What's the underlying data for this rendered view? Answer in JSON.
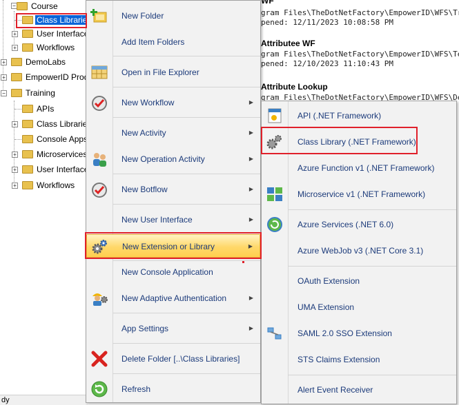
{
  "tree": {
    "items": [
      {
        "label": "Course",
        "expander": "-"
      },
      {
        "label": "Class Libraries",
        "selected": true
      },
      {
        "label": "User Interface",
        "expander": "+"
      },
      {
        "label": "Workflows",
        "expander": "+"
      },
      {
        "label": "DemoLabs",
        "expander": "+"
      },
      {
        "label": "EmpowerID Prod",
        "expander": "+"
      },
      {
        "label": "Training",
        "expander": "-"
      },
      {
        "label": "APIs"
      },
      {
        "label": "Class Libraries",
        "expander": "+"
      },
      {
        "label": "Console Apps"
      },
      {
        "label": "Microservices",
        "expander": "+"
      },
      {
        "label": "User Interface",
        "expander": "+"
      },
      {
        "label": "Workflows",
        "expander": "+"
      }
    ]
  },
  "statusbar": {
    "text": "dy"
  },
  "background": {
    "lines": [
      "WF",
      "gram Files\\TheDotNetFactory\\EmpowerID\\WFS\\Tra",
      "pened: 12/11/2023 10:08:58 PM",
      "Attributee WF",
      "gram Files\\TheDotNetFactory\\EmpowerID\\WFS\\Te",
      "pened: 12/10/2023 11:10:43 PM",
      "Attribute Lookup",
      "gram Files\\TheDotNetFactory\\EmpowerID\\WFS\\De"
    ]
  },
  "menu": {
    "items": [
      {
        "label": "New Folder",
        "icon": "new-folder-icon"
      },
      {
        "label": "Add Item Folders",
        "icon": ""
      },
      {
        "label": "Open in File Explorer",
        "icon": "file-explorer-icon"
      },
      {
        "label": "New Workflow",
        "icon": "workflow-icon",
        "submenu": true
      },
      {
        "label": "New Activity",
        "icon": "",
        "submenu": true
      },
      {
        "label": "New Operation Activity",
        "icon": "people-icon",
        "submenu": true
      },
      {
        "label": "New Botflow",
        "icon": "botflow-icon",
        "submenu": true
      },
      {
        "label": "New User Interface",
        "icon": "",
        "submenu": true
      },
      {
        "label": "New Extension or Library",
        "icon": "gears-icon",
        "submenu": true
      },
      {
        "label": "New Console Application",
        "icon": ""
      },
      {
        "label": "New Adaptive Authentication",
        "icon": "worker-gear-icon",
        "submenu": true
      },
      {
        "label": "App Settings",
        "icon": "",
        "submenu": true
      },
      {
        "label": "Delete Folder [..\\Class Libraries]",
        "icon": "delete-icon"
      },
      {
        "label": "Refresh",
        "icon": "refresh-icon"
      }
    ]
  },
  "submenu": {
    "items": [
      {
        "label": "API (.NET Framework)",
        "icon": "api-icon"
      },
      {
        "label": "Class Library (.NET Framework)",
        "icon": "gears-icon"
      },
      {
        "label": "Azure Function v1 (.NET Framework)",
        "icon": ""
      },
      {
        "label": "Microservice v1 (.NET Framework)",
        "icon": "microservice-icon"
      },
      {
        "label": "Azure Services (.NET 6.0)",
        "icon": "azure-services-icon"
      },
      {
        "label": "Azure WebJob v3 (.NET Core 3.1)",
        "icon": ""
      },
      {
        "label": "OAuth Extension",
        "icon": ""
      },
      {
        "label": "UMA Extension",
        "icon": ""
      },
      {
        "label": "SAML 2.0 SSO Extension",
        "icon": "saml-icon"
      },
      {
        "label": "STS Claims Extension",
        "icon": ""
      },
      {
        "label": "Alert Event Receiver",
        "icon": ""
      }
    ]
  },
  "colors": {
    "highlight_border": "#e0202a",
    "selection": "#0a64d8",
    "menu_text": "#1b3a7a"
  }
}
